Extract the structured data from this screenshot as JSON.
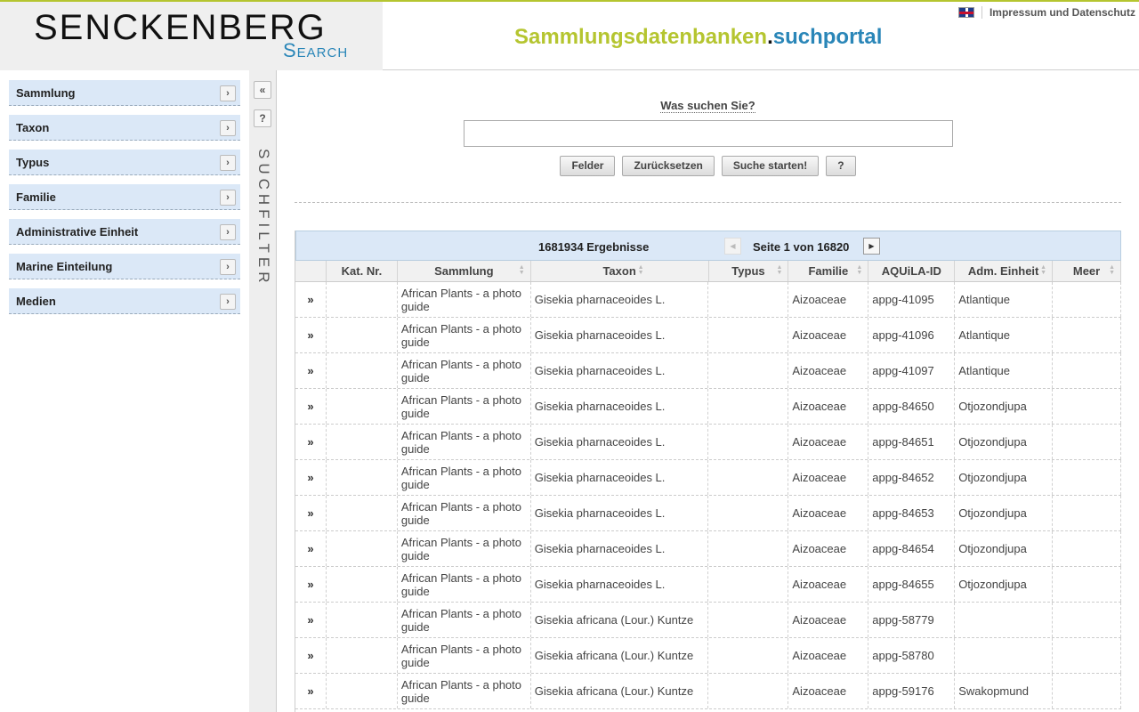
{
  "header": {
    "logo_main": "SENCKENBERG",
    "logo_sub": "Search",
    "portal_part1": "Sammlungsdatenbanken",
    "portal_part2": ".",
    "portal_part3": "suchportal",
    "imprint": "Impressum und Datenschutz"
  },
  "sidebar": {
    "items": [
      {
        "label": "Sammlung"
      },
      {
        "label": "Taxon"
      },
      {
        "label": "Typus"
      },
      {
        "label": "Familie"
      },
      {
        "label": "Administrative Einheit"
      },
      {
        "label": "Marine Einteilung"
      },
      {
        "label": "Medien"
      }
    ],
    "arrow": "›"
  },
  "strip": {
    "collapse": "«",
    "help": "?",
    "label": "SUCHFILTER"
  },
  "search": {
    "label": "Was suchen Sie?",
    "value": "",
    "buttons": {
      "fields": "Felder",
      "reset": "Zurücksetzen",
      "start": "Suche starten!",
      "help": "?"
    }
  },
  "grid": {
    "count": "1681934 Ergebnisse",
    "pager": "Seite 1 von 16820",
    "columns": [
      "",
      "Kat. Nr.",
      "Sammlung",
      "Taxon",
      "Typus",
      "Familie",
      "AQUiLA-ID",
      "Adm. Einheit",
      "Meer"
    ],
    "expand_glyph": "»",
    "rows": [
      {
        "kat": "",
        "sammlung": "African Plants - a photo guide",
        "taxon": "Gisekia pharnaceoides L.",
        "typus": "",
        "familie": "Aizoaceae",
        "id": "appg-41095",
        "adm": "Atlantique",
        "meer": ""
      },
      {
        "kat": "",
        "sammlung": "African Plants - a photo guide",
        "taxon": "Gisekia pharnaceoides L.",
        "typus": "",
        "familie": "Aizoaceae",
        "id": "appg-41096",
        "adm": "Atlantique",
        "meer": ""
      },
      {
        "kat": "",
        "sammlung": "African Plants - a photo guide",
        "taxon": "Gisekia pharnaceoides L.",
        "typus": "",
        "familie": "Aizoaceae",
        "id": "appg-41097",
        "adm": "Atlantique",
        "meer": ""
      },
      {
        "kat": "",
        "sammlung": "African Plants - a photo guide",
        "taxon": "Gisekia pharnaceoides L.",
        "typus": "",
        "familie": "Aizoaceae",
        "id": "appg-84650",
        "adm": "Otjozondjupa",
        "meer": ""
      },
      {
        "kat": "",
        "sammlung": "African Plants - a photo guide",
        "taxon": "Gisekia pharnaceoides L.",
        "typus": "",
        "familie": "Aizoaceae",
        "id": "appg-84651",
        "adm": "Otjozondjupa",
        "meer": ""
      },
      {
        "kat": "",
        "sammlung": "African Plants - a photo guide",
        "taxon": "Gisekia pharnaceoides L.",
        "typus": "",
        "familie": "Aizoaceae",
        "id": "appg-84652",
        "adm": "Otjozondjupa",
        "meer": ""
      },
      {
        "kat": "",
        "sammlung": "African Plants - a photo guide",
        "taxon": "Gisekia pharnaceoides L.",
        "typus": "",
        "familie": "Aizoaceae",
        "id": "appg-84653",
        "adm": "Otjozondjupa",
        "meer": ""
      },
      {
        "kat": "",
        "sammlung": "African Plants - a photo guide",
        "taxon": "Gisekia pharnaceoides L.",
        "typus": "",
        "familie": "Aizoaceae",
        "id": "appg-84654",
        "adm": "Otjozondjupa",
        "meer": ""
      },
      {
        "kat": "",
        "sammlung": "African Plants - a photo guide",
        "taxon": "Gisekia pharnaceoides L.",
        "typus": "",
        "familie": "Aizoaceae",
        "id": "appg-84655",
        "adm": "Otjozondjupa",
        "meer": ""
      },
      {
        "kat": "",
        "sammlung": "African Plants - a photo guide",
        "taxon": "Gisekia africana (Lour.) Kuntze",
        "typus": "",
        "familie": "Aizoaceae",
        "id": "appg-58779",
        "adm": "",
        "meer": ""
      },
      {
        "kat": "",
        "sammlung": "African Plants - a photo guide",
        "taxon": "Gisekia africana (Lour.) Kuntze",
        "typus": "",
        "familie": "Aizoaceae",
        "id": "appg-58780",
        "adm": "",
        "meer": ""
      },
      {
        "kat": "",
        "sammlung": "African Plants - a photo guide",
        "taxon": "Gisekia africana (Lour.) Kuntze",
        "typus": "",
        "familie": "Aizoaceae",
        "id": "appg-59176",
        "adm": "Swakopmund",
        "meer": ""
      }
    ]
  },
  "colors": {
    "accent_green": "#b5c530",
    "accent_blue": "#2a86b8",
    "panel_blue": "#dbe8f7"
  }
}
